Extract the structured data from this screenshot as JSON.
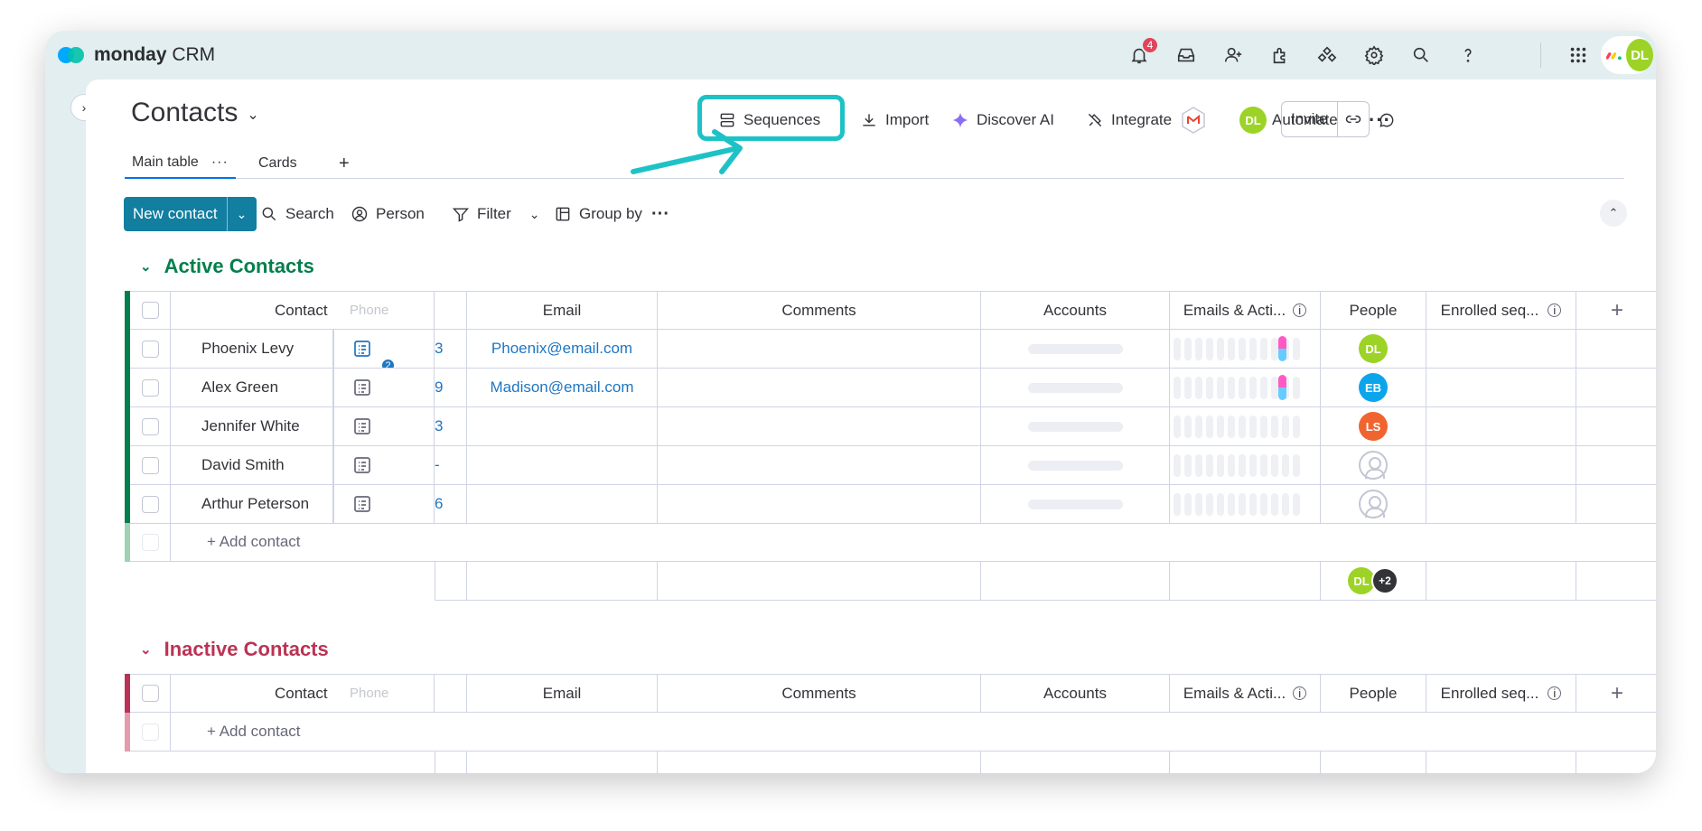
{
  "app": {
    "brand": "monday",
    "brand_sub": " CRM",
    "notification_count": "4",
    "user_initials": "DL"
  },
  "header": {
    "title": "Contacts",
    "toolbar": {
      "sequences": "Sequences",
      "import": "Import",
      "discover_ai": "Discover AI",
      "integrate": "Integrate",
      "automate": "Automate",
      "invite": "Invite"
    },
    "avatar_initials": "DL"
  },
  "tabs": [
    {
      "label": "Main table"
    },
    {
      "label": "Cards"
    },
    {
      "label": "+"
    }
  ],
  "controls": {
    "new_contact": "New contact",
    "search": "Search",
    "person": "Person",
    "filter": "Filter",
    "group_by": "Group by"
  },
  "columns": {
    "contact": "Contact",
    "phone": "Phone",
    "email": "Email",
    "comments": "Comments",
    "accounts": "Accounts",
    "emails_activities": "Emails & Acti...",
    "people": "People",
    "enrolled": "Enrolled seq..."
  },
  "groups": [
    {
      "title": "Active Contacts",
      "color": "#037f4c",
      "add_label": "+ Add contact",
      "rows": [
        {
          "name": "Phoenix Levy",
          "phone_tail": "3",
          "email": "Phoenix@email.com",
          "updates": "2",
          "person": "DL",
          "person_color": "#9cd326",
          "activity": true
        },
        {
          "name": "Alex Green",
          "phone_tail": "9",
          "email": "Madison@email.com",
          "updates": "",
          "person": "EB",
          "person_color": "#0ba5ec",
          "activity": true
        },
        {
          "name": "Jennifer White",
          "phone_tail": "3",
          "email": "",
          "updates": "",
          "person": "LS",
          "person_color": "#f0652f",
          "activity": false
        },
        {
          "name": "David Smith",
          "phone_tail": "-",
          "email": "",
          "updates": "",
          "person": "",
          "person_color": "",
          "activity": false
        },
        {
          "name": "Arthur Peterson",
          "phone_tail": "6",
          "email": "",
          "updates": "",
          "person": "",
          "person_color": "",
          "activity": false
        }
      ],
      "summary_people": {
        "initials": "DL",
        "more": "+2"
      }
    },
    {
      "title": "Inactive Contacts",
      "color": "#bb3354",
      "add_label": "+ Add contact",
      "rows": []
    }
  ],
  "colors": {
    "accent": "#127ea0",
    "highlight": "#1ec2c6",
    "active_group": "#037f4c",
    "inactive_group": "#bb3354"
  }
}
